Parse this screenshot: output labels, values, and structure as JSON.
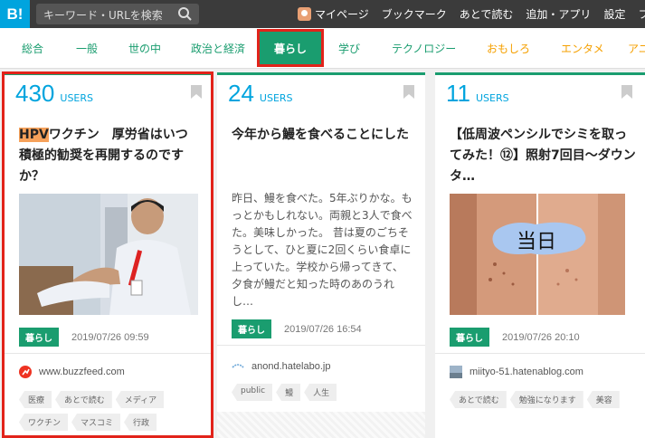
{
  "header": {
    "logo": "B!",
    "search_placeholder": "キーワード・URLを検索",
    "nav": [
      "マイページ",
      "ブックマーク",
      "あとで読む",
      "追加・アプリ",
      "設定",
      "フィ"
    ]
  },
  "categories": [
    "総合",
    "一般",
    "世の中",
    "政治と経済",
    "暮らし",
    "学び",
    "テクノロジー",
    "おもしろ",
    "エンタメ",
    "アニ"
  ],
  "category_colors": [
    "#1a9d6f",
    "#1a9d6f",
    "#1a9d6f",
    "#1a9d6f",
    "#ffffff",
    "#1a9d6f",
    "#1a9d6f",
    "#f5a000",
    "#f5a000",
    "#f5a000"
  ],
  "active_category": "暮らし",
  "entries": [
    {
      "count": "430",
      "users": "USERS",
      "title_highlight": "HPV",
      "title_rest": "ワクチン　厚労省はいつ積極的勧奨を再開するのですか？",
      "category": "暮らし",
      "date": "2019/07/26 09:59",
      "site": "www.buzzfeed.com",
      "tags": [
        "医療",
        "あとで読む",
        "メディア",
        "ワクチン",
        "マスコミ",
        "行政"
      ]
    },
    {
      "count": "24",
      "users": "USERS",
      "title": "今年から鰻を食べることにした",
      "excerpt": "昨日、鰻を食べた。5年ぶりかな。もっとかもしれない。両親と3人で食べた。美味しかった。 昔は夏のごちそうとして、ひと夏に2回くらい食卓に上っていた。学校から帰ってきて、夕食が鰻だと知った時のあのうれし…",
      "category": "暮らし",
      "date": "2019/07/26 16:54",
      "site": "anond.hatelabo.jp",
      "tags": [
        "public",
        "鰻",
        "人生"
      ]
    },
    {
      "count": "11",
      "users": "USERS",
      "title": "【低周波ペンシルでシミを取ってみた！⑫】照射7回目〜ダウンタ…",
      "image_label": "当日",
      "category": "暮らし",
      "date": "2019/07/26 20:10",
      "site": "miityo-51.hatenablog.com",
      "tags": [
        "あとで読む",
        "勉強になります",
        "美容"
      ]
    }
  ]
}
